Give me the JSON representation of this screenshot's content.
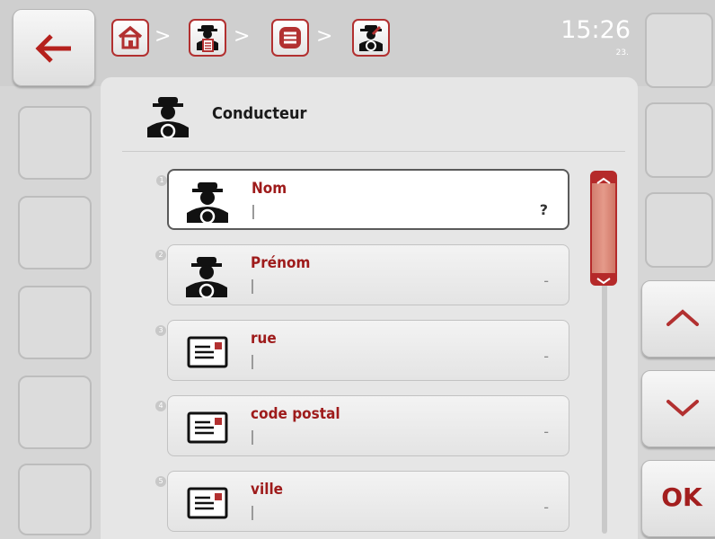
{
  "navigation": {
    "back_icon": "arrow-left-icon",
    "breadcrumb": [
      {
        "icon": "home-icon"
      },
      {
        "separator": ">",
        "icon": "driver-list-icon"
      },
      {
        "separator": ">",
        "icon": "list-icon"
      },
      {
        "separator": ">",
        "icon": "driver-edit-icon"
      }
    ]
  },
  "clock": {
    "time": "15:26",
    "sub": "23."
  },
  "header": {
    "title": "Conducteur",
    "icon": "driver-icon"
  },
  "fields": [
    {
      "number": "1",
      "label": "Nom",
      "value": "?",
      "icon": "driver-icon"
    },
    {
      "number": "2",
      "label": "Prénom",
      "value": "-",
      "icon": "driver-icon"
    },
    {
      "number": "3",
      "label": "rue",
      "value": "-",
      "icon": "address-card-icon"
    },
    {
      "number": "4",
      "label": "code postal",
      "value": "-",
      "icon": "address-card-icon"
    },
    {
      "number": "5",
      "label": "ville",
      "value": "-",
      "icon": "address-card-icon"
    }
  ],
  "side": {
    "ok_label": "OK",
    "up_icon": "chevron-up-icon",
    "down_icon": "chevron-down-icon"
  },
  "colors": {
    "accent": "#b23030",
    "label": "#9e1b1b"
  }
}
